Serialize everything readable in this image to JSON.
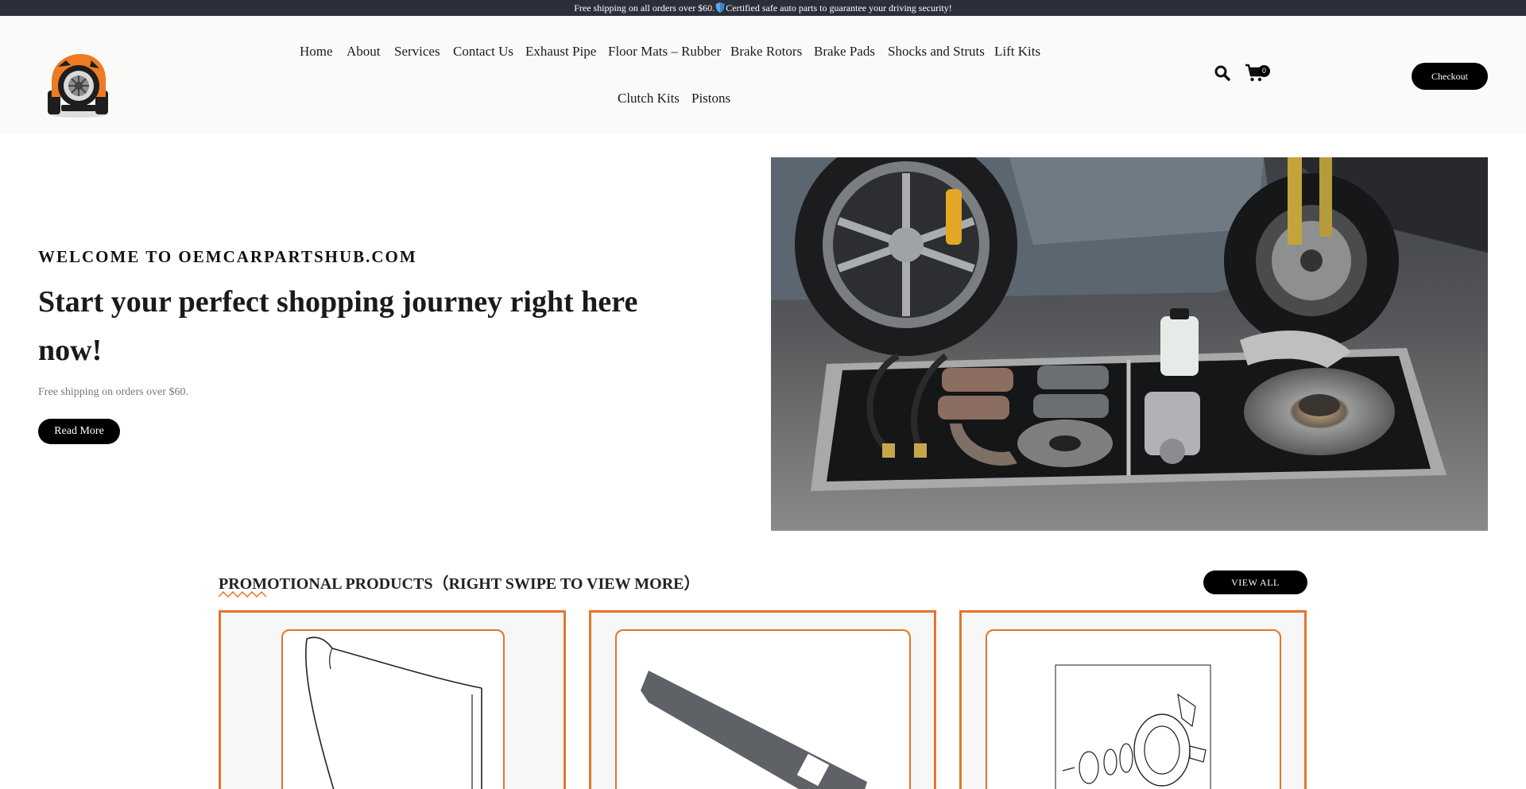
{
  "topbar": {
    "text_before": "Free shipping on all orders over $60.",
    "text_after": "Certified safe auto parts to guarantee your driving security!"
  },
  "header": {
    "logo_icon": "wheel-tire-logo",
    "nav": [
      {
        "label": "Home"
      },
      {
        "label": "About"
      },
      {
        "label": "Services"
      },
      {
        "label": "Contact Us"
      },
      {
        "label": "Exhaust Pipe"
      },
      {
        "label": "Floor Mats – Rubber"
      },
      {
        "label": "Brake Rotors"
      },
      {
        "label": "Brake Pads"
      },
      {
        "label": "Shocks and Struts"
      },
      {
        "label": "Lift Kits"
      },
      {
        "label": "Clutch Kits"
      },
      {
        "label": "Pistons"
      }
    ],
    "search_icon": "search-icon",
    "cart_icon": "cart-icon",
    "cart_count": "0",
    "checkout_label": "Checkout"
  },
  "hero": {
    "kicker": "WELCOME TO OEMCARPARTSHUB.COM",
    "title": "Start your perfect shopping journey right here now!",
    "subtitle": "Free shipping on orders over $60.",
    "button_label": "Read More"
  },
  "promo": {
    "title": "PROMOTIONAL PRODUCTS（RIGHT SWIPE TO VIEW MORE）",
    "view_all_label": "VIEW ALL",
    "accent_color": "#e4752a"
  }
}
